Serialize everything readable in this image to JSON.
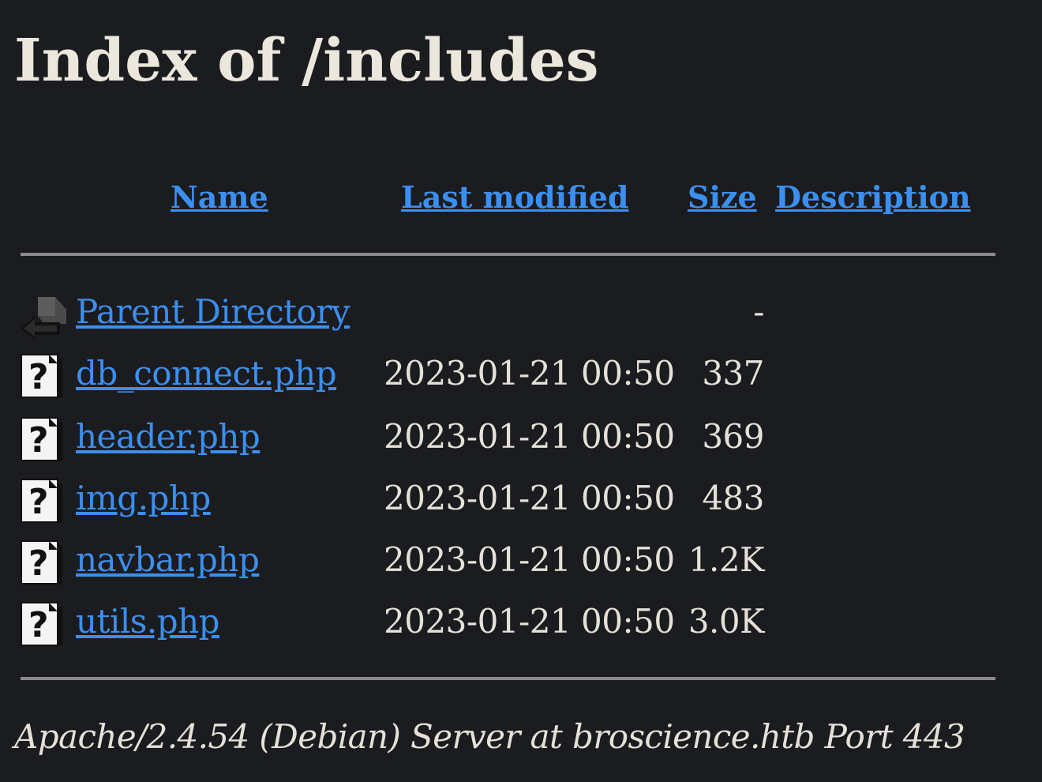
{
  "page": {
    "title": "Index of /includes"
  },
  "table": {
    "headers": {
      "name": "Name",
      "last_modified": "Last modified",
      "size": "Size",
      "description": "Description"
    },
    "rows": [
      {
        "icon": "parent-directory-icon",
        "name": "Parent Directory",
        "last_modified": "",
        "size": "-",
        "description": ""
      },
      {
        "icon": "unknown-file-icon",
        "name": "db_connect.php",
        "last_modified": "2023-01-21 00:50",
        "size": "337",
        "description": ""
      },
      {
        "icon": "unknown-file-icon",
        "name": "header.php",
        "last_modified": "2023-01-21 00:50",
        "size": "369",
        "description": ""
      },
      {
        "icon": "unknown-file-icon",
        "name": "img.php",
        "last_modified": "2023-01-21 00:50",
        "size": "483",
        "description": ""
      },
      {
        "icon": "unknown-file-icon",
        "name": "navbar.php",
        "last_modified": "2023-01-21 00:50",
        "size": "1.2K",
        "description": ""
      },
      {
        "icon": "unknown-file-icon",
        "name": "utils.php",
        "last_modified": "2023-01-21 00:50",
        "size": "3.0K",
        "description": ""
      }
    ]
  },
  "footer": {
    "address": "Apache/2.4.54 (Debian) Server at broscience.htb Port 443"
  },
  "colors": {
    "background": "#1b1c1f",
    "link": "#3b8ff0",
    "text": "#e6e1d8",
    "rule": "#8a8a8a"
  }
}
